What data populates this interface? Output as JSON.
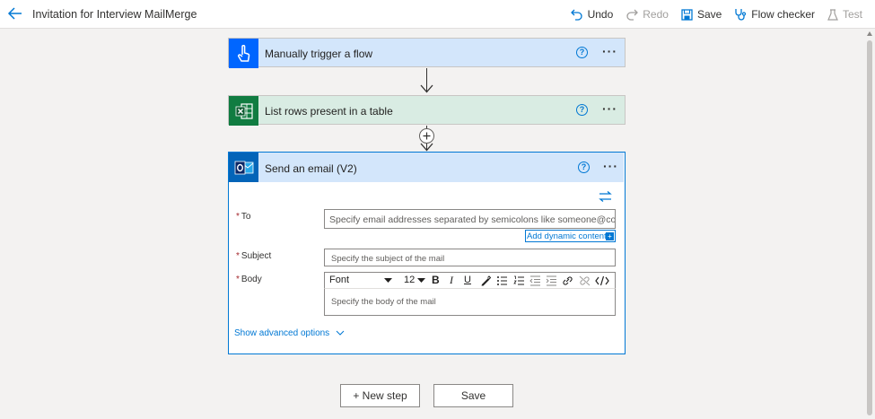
{
  "header": {
    "title": "Invitation for Interview MailMerge",
    "undo_label": "Undo",
    "redo_label": "Redo",
    "save_label": "Save",
    "flow_checker_label": "Flow checker",
    "test_label": "Test"
  },
  "steps": {
    "trigger": {
      "title": "Manually trigger a flow",
      "color": "#0066ff",
      "header_bg": "#d3e6fb"
    },
    "list_rows": {
      "title": "List rows present in a table",
      "color": "#107c41",
      "header_bg": "#d9ece3"
    },
    "send_email": {
      "title": "Send an email (V2)",
      "color": "#0364b8",
      "header_bg": "#d3e6fb"
    }
  },
  "icons": {
    "help": "?",
    "more": "···"
  },
  "email_form": {
    "required_marker": "*",
    "to_label": "To",
    "to_placeholder": "Specify email addresses separated by semicolons like someone@contoso.com",
    "add_dynamic_label": "Add dynamic content",
    "subject_label": "Subject",
    "subject_placeholder": "Specify the subject of the mail",
    "body_label": "Body",
    "font_label": "Font",
    "font_size": "12",
    "body_placeholder": "Specify the body of the mail",
    "show_advanced_label": "Show advanced options"
  },
  "footer": {
    "new_step_label": "+ New step",
    "save_label": "Save"
  }
}
